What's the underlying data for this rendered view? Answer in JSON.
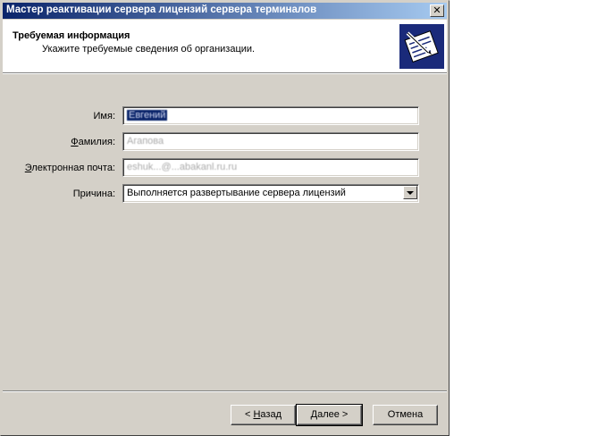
{
  "window": {
    "title": "Мастер реактивации сервера лицензий сервера терминалов",
    "close_glyph": "✕"
  },
  "header": {
    "title": "Требуемая информация",
    "subtitle": "Укажите требуемые сведения об организации.",
    "icon": "wizard-document-pen-icon"
  },
  "form": {
    "first_name_label": "Имя:",
    "first_name_value": "Евгений",
    "last_name_label_key": "Ф",
    "last_name_label_rest": "амилия:",
    "last_name_value": "Агапова",
    "email_label_key": "Э",
    "email_label_rest": "лектронная почта:",
    "email_value": "eshuk...@...abakanl.ru.ru",
    "reason_label": "Причина:",
    "reason_value": "Выполняется развертывание сервера лицензий"
  },
  "buttons": {
    "back_prefix": "< ",
    "back_key": "Н",
    "back_rest": "азад",
    "next_key": "Д",
    "next_rest": "алее >",
    "cancel": "Отмена"
  },
  "colors": {
    "titlebar_start": "#0a246a",
    "titlebar_end": "#a6caf0",
    "dialog_bg": "#d4d0c8",
    "icon_bg": "#1a2a7a"
  }
}
